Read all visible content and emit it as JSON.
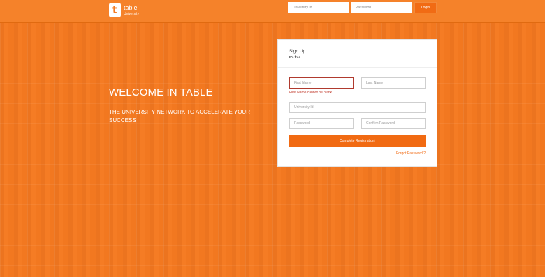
{
  "topbar": {
    "logo_letter": "t",
    "brand_name": "table",
    "brand_sub": "University",
    "university_id_placeholder": "University Id",
    "password_placeholder": "Password",
    "login_label": "Login"
  },
  "hero": {
    "title": "WELCOME IN TABLE",
    "subtitle": "THE UNIVERSITY NETWORK TO ACCELERATE YOUR SUCCESS"
  },
  "signup": {
    "title": "Sign Up",
    "subtitle": "It's free",
    "first_name_placeholder": "First Name",
    "last_name_placeholder": "Last Name",
    "first_name_error": "First Name cannot be blank.",
    "university_id_placeholder": "University Id",
    "password_placeholder": "Password",
    "confirm_password_placeholder": "Confirm Password",
    "submit_label": "Complete Registration!",
    "forgot_label": "Forgot Password ?"
  },
  "colors": {
    "accent": "#f47a20",
    "error": "#c0392b"
  }
}
